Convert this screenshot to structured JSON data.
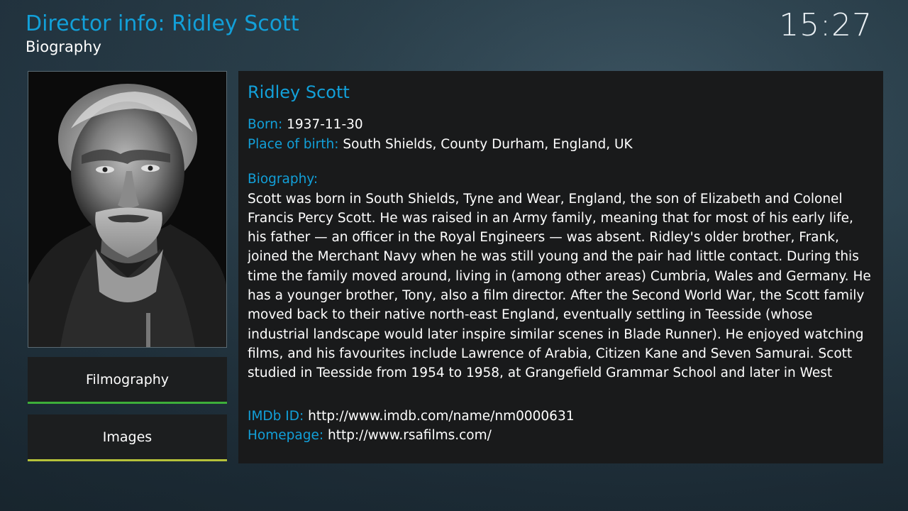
{
  "header": {
    "title": "Director info: Ridley Scott",
    "subtitle": "Biography",
    "clock": "15:27"
  },
  "poster": {
    "icon": "director-portrait"
  },
  "nav": {
    "filmography_label": "Filmography",
    "images_label": "Images"
  },
  "info": {
    "name": "Ridley Scott",
    "born_label": "Born:",
    "born_value": "1937-11-30",
    "birthplace_label": "Place of birth:",
    "birthplace_value": "South Shields, County Durham, England, UK",
    "biography_label": "Biography:",
    "biography_text": "Scott was born in South Shields, Tyne and Wear, England, the son of Elizabeth and Colonel Francis Percy Scott. He was raised in an Army family, meaning that for most of his early life, his father — an officer in the Royal Engineers — was absent. Ridley's older brother, Frank, joined the Merchant Navy when he was still young and the pair had little contact. During this time the family moved around, living in (among other areas) Cumbria, Wales and Germany. He has a younger brother, Tony, also a film director. After the Second World War, the Scott family moved back to their native north-east England, eventually settling in Teesside (whose industrial landscape would later inspire similar scenes in Blade Runner). He enjoyed watching films, and his favourites include Lawrence of Arabia, Citizen Kane and Seven Samurai. Scott studied in Teesside from 1954 to 1958, at Grangefield Grammar School and later in West",
    "imdb_label": "IMDb ID:",
    "imdb_value": "http://www.imdb.com/name/nm0000631",
    "homepage_label": "Homepage:",
    "homepage_value": "http://www.rsafilms.com/"
  },
  "colors": {
    "accent": "#12a0d9",
    "panel": "#191a1b",
    "filmography_underline": "#3dae3a",
    "images_underline": "#b6c23a"
  }
}
